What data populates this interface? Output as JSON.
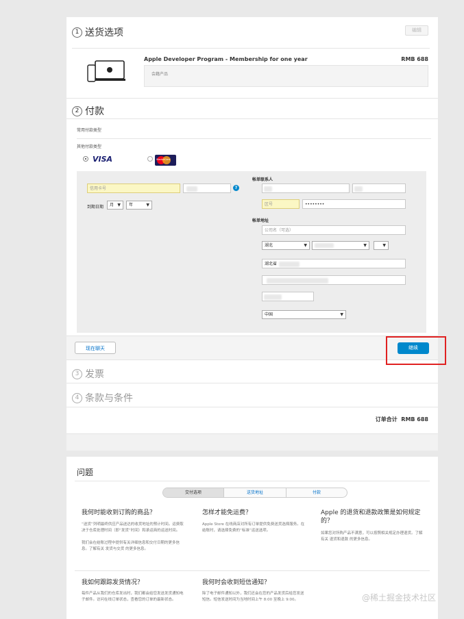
{
  "steps": {
    "shipping": {
      "num": "1",
      "title": "送货选项",
      "edit_label": "编辑"
    },
    "payment": {
      "num": "2",
      "title": "付款"
    },
    "invoice": {
      "num": "3",
      "title": "发票"
    },
    "terms": {
      "num": "4",
      "title": "条款与条件"
    }
  },
  "product": {
    "name": "Apple Developer Program - Membership for one year",
    "price": "RMB 688",
    "note": "会籍产品"
  },
  "payment": {
    "common_types_label": "常用付款类型",
    "other_types_label": "其他付款类型",
    "visa_label": "VISA",
    "mastercard_label": "MasterCard",
    "card_number_placeholder": "信用卡号",
    "expiry_label": "到期日期",
    "month_label": "月",
    "year_label": "年",
    "help_icon": "?",
    "billing_contact_label": "帐单联系人",
    "area_code_placeholder": "区号",
    "phone_value": "••••••••",
    "billing_address_label": "帐单地址",
    "company_placeholder": "公司名（可选）",
    "province_value": "湖北",
    "address_value": "湖北省",
    "country_value": "中国",
    "chat_button": "现在聊天",
    "continue_button": "继续"
  },
  "order": {
    "total_label": "订单合计",
    "total_value": "RMB 688"
  },
  "faq": {
    "title": "问题",
    "tabs": [
      "交付选项",
      "送货地址",
      "付款"
    ],
    "items": [
      {
        "q": "我何时能收到订购的商品？",
        "a": "“送货”列明最终供应产品送达的收货地址的预计时间。运费取决于仓库处理时间（即“发货”时间）和承运商的运送时间。\n\n我们会在结账过程中提供有关详细信息和交付日期的更多信息。了解有关 发货与交货 的更多信息。"
      },
      {
        "q": "怎样才能免运费？",
        "a": "Apple Store 在线商店对所有订单提供免费送货选择服务。在结账时，请选择免费的“标准”运送选项。"
      },
      {
        "q": "Apple 的退货和退款政策是如何规定的？",
        "a": "如果您对所购产品不满意，可以按照相关规定办理退货。了解有关 退货和退款 的更多信息。"
      },
      {
        "q": "我如何跟踪发货情况？",
        "a": "每件产品从我们的仓库发出时，我们都会给您发送发货通知电子邮件。访问在线订单状态，查看您的订单的最新状态。"
      },
      {
        "q": "我何时会收到短信通知？",
        "a": "除了电子邮件通知以外，我们还会在您的产品发货后给您发送短信。短信发送时间为当地时间上午 8:00 至晚上 9:00。"
      }
    ]
  },
  "watermark": "@稀土掘金技术社区",
  "colors": {
    "accent": "#0088cc",
    "highlight_border": "#e02020",
    "link": "#0070c9"
  }
}
